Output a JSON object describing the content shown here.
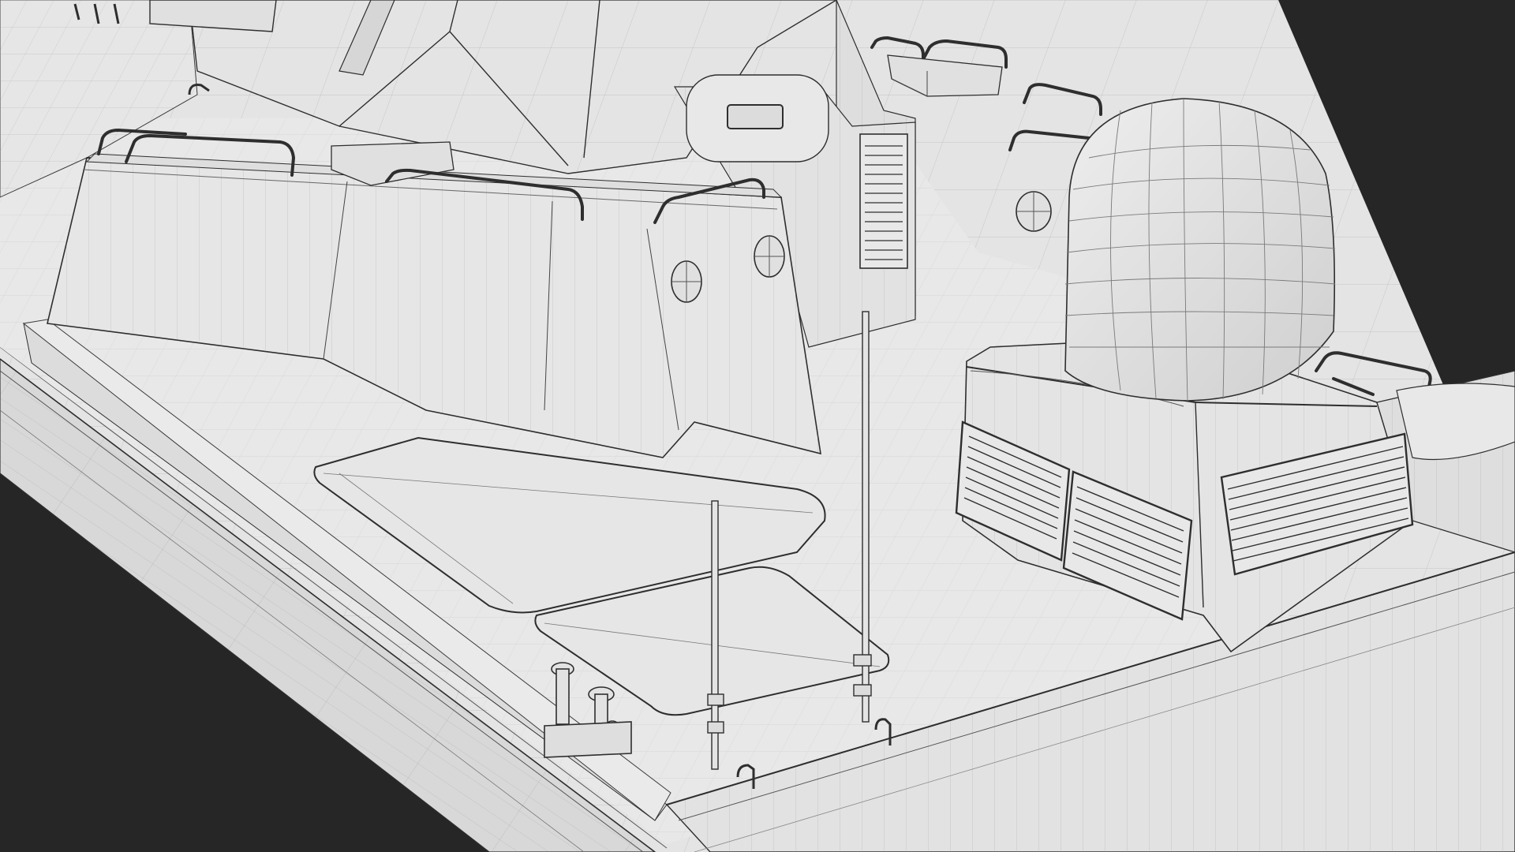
{
  "scene": {
    "subject": "patrol-boat-wireframe",
    "render_mode": "wireframe-on-clay",
    "colors": {
      "background": "#262626",
      "surface": "#e6e6e6",
      "surface_shade": "#dadada",
      "surface_dark": "#cfcfcf",
      "wire": "#7a7a7a",
      "edge": "#2e2e2e"
    },
    "components": [
      "hull",
      "deck",
      "superstructure",
      "bridge-mast",
      "bulwark-block",
      "radome",
      "ventilation-grilles",
      "portholes",
      "railings",
      "hatches",
      "antenna-poles",
      "bollards"
    ]
  }
}
